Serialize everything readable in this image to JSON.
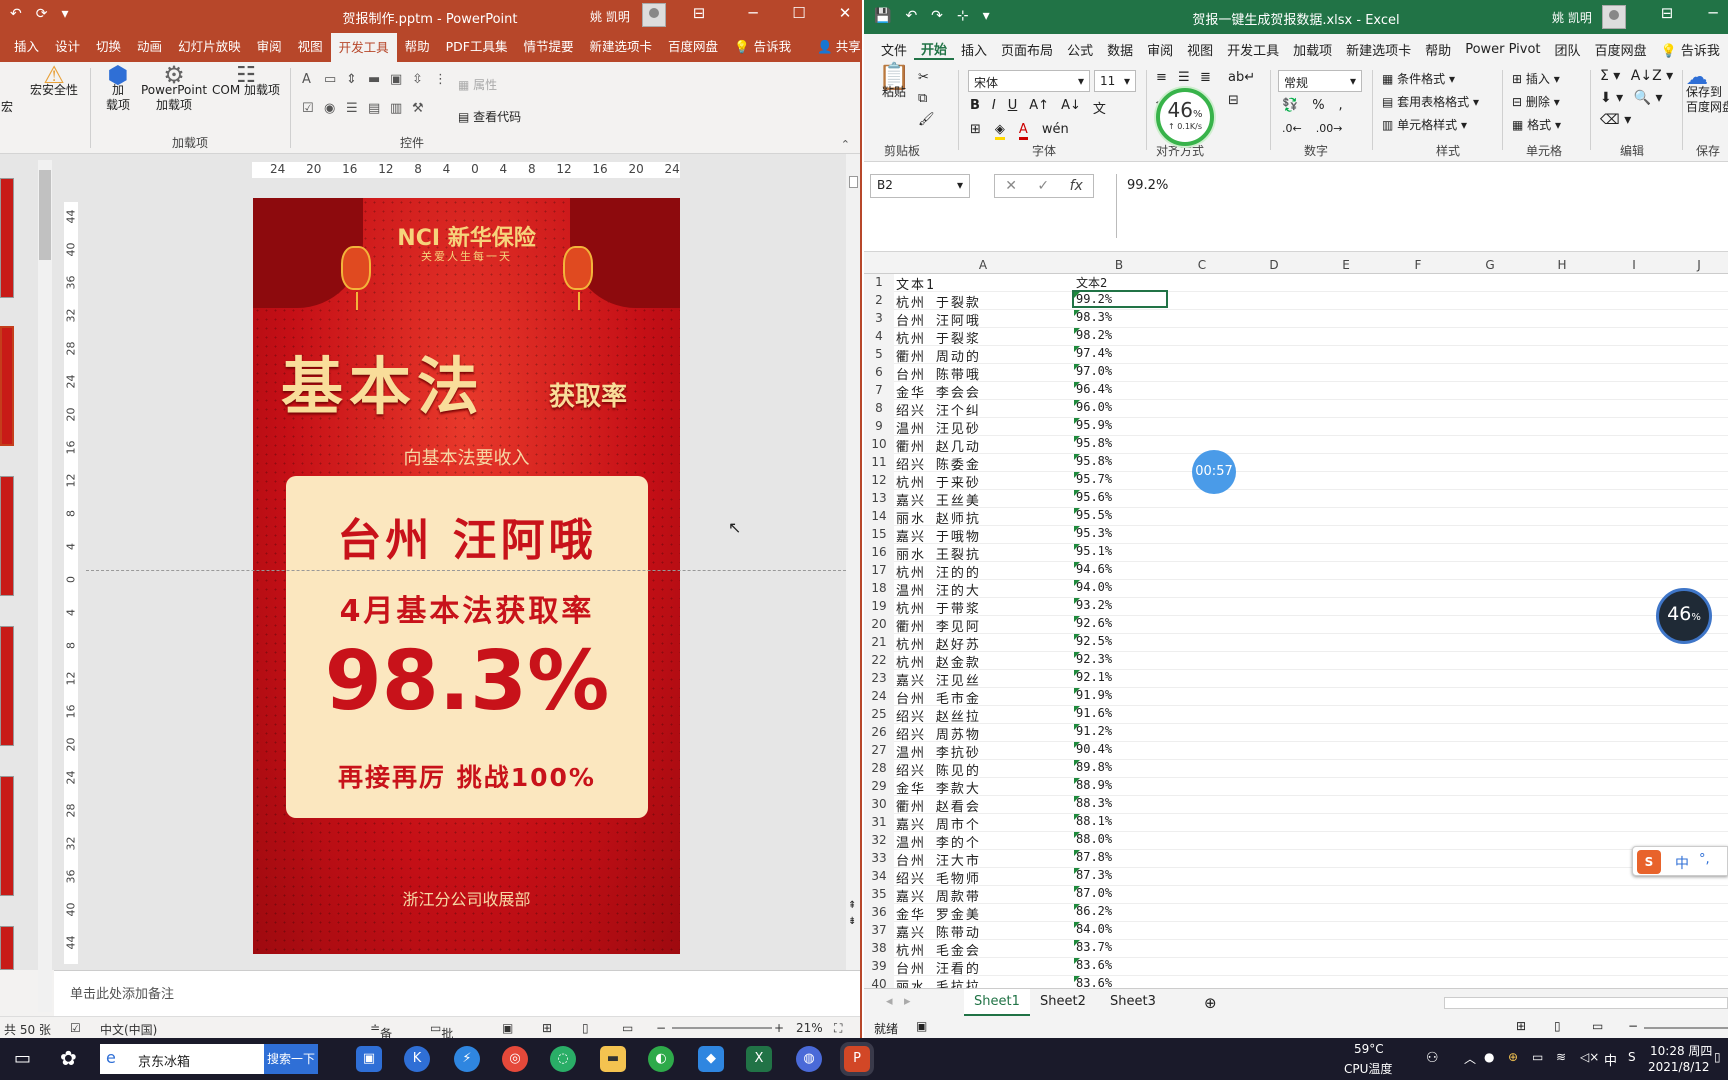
{
  "ppt": {
    "title": "贺报制作.pptm  -  PowerPoint",
    "user": "姚 凯明",
    "tabs": [
      "插入",
      "设计",
      "切换",
      "动画",
      "幻灯片放映",
      "审阅",
      "视图",
      "开发工具",
      "帮助",
      "PDF工具集",
      "情节提要",
      "新建选项卡",
      "百度网盘",
      "告诉我",
      "共享"
    ],
    "active_tab": "开发工具",
    "ribbon": {
      "macro": "宏",
      "macro_security": "宏安全性",
      "addins": "加\n载项",
      "ppt_addins": "PowerPoint\n加载项",
      "com_addins": "COM 加载项",
      "addins_group": "加载项",
      "properties": "属性",
      "view_code": "查看代码",
      "controls_group": "控件"
    },
    "hruler": [
      "24",
      "20",
      "16",
      "12",
      "8",
      "4",
      "0",
      "4",
      "8",
      "12",
      "16",
      "20",
      "24"
    ],
    "vruler": [
      "44",
      "40",
      "36",
      "32",
      "28",
      "24",
      "20",
      "16",
      "12",
      "8",
      "4",
      "0",
      "4",
      "8",
      "12",
      "16",
      "20",
      "24",
      "28",
      "32",
      "36",
      "40",
      "44"
    ],
    "slide": {
      "logo": "NCI 新华保险",
      "slogan": "关爱人生每一天",
      "big": "基本法",
      "big_sub": "获取率",
      "sub": "向基本法要收入",
      "name": "台州  汪阿哦",
      "line": "4月基本法获取率",
      "pct": "98.3%",
      "motto": "再接再厉  挑战100%",
      "foot": "浙江分公司收展部"
    },
    "notes_placeholder": "单击此处添加备注",
    "status": {
      "slides": "共 50 张",
      "lang": "中文(中国)",
      "notes": "备注",
      "comments": "批注",
      "zoom": "21%"
    }
  },
  "excel": {
    "title": "贺报一键生成贺报数据.xlsx  -  Excel",
    "user": "姚 凯明",
    "tabs": [
      "文件",
      "开始",
      "插入",
      "页面布局",
      "公式",
      "数据",
      "审阅",
      "视图",
      "开发工具",
      "加载项",
      "新建选项卡",
      "帮助",
      "Power Pivot",
      "团队",
      "百度网盘",
      "告诉我"
    ],
    "active_tab": "开始",
    "ribbon": {
      "paste": "粘贴",
      "clipboard": "剪贴板",
      "font_name": "宋体",
      "font_size": "11",
      "font_group": "字体",
      "align_group": "对齐方式",
      "number_format": "常规",
      "number_group": "数字",
      "cond_format": "条件格式",
      "table_format": "套用表格格式",
      "cell_style": "单元格样式",
      "styles_group": "样式",
      "insert": "插入",
      "delete": "删除",
      "format": "格式",
      "cells_group": "单元格",
      "editing_group": "编辑",
      "save_baidu": "保存到\n百度网盘",
      "save_group": "保存"
    },
    "namebox": "B2",
    "formula": "99.2%",
    "columns": [
      "A",
      "B",
      "C",
      "D",
      "E",
      "F",
      "G",
      "H",
      "I",
      "J"
    ],
    "rows": [
      [
        "文本1",
        "文本2"
      ],
      [
        "杭州 于裂款",
        "99.2%"
      ],
      [
        "台州 汪阿哦",
        "98.3%"
      ],
      [
        "杭州 于裂浆",
        "98.2%"
      ],
      [
        "衢州 周动的",
        "97.4%"
      ],
      [
        "台州 陈带哦",
        "97.0%"
      ],
      [
        "金华 李会会",
        "96.4%"
      ],
      [
        "绍兴 汪个纠",
        "96.0%"
      ],
      [
        "温州 汪见砂",
        "95.9%"
      ],
      [
        "衢州 赵几动",
        "95.8%"
      ],
      [
        "绍兴 陈委金",
        "95.8%"
      ],
      [
        "杭州 于来砂",
        "95.7%"
      ],
      [
        "嘉兴 王丝美",
        "95.6%"
      ],
      [
        "丽水 赵师抗",
        "95.5%"
      ],
      [
        "嘉兴 于哦物",
        "95.3%"
      ],
      [
        "丽水 王裂抗",
        "95.1%"
      ],
      [
        "杭州 汪的的",
        "94.6%"
      ],
      [
        "温州 汪的大",
        "94.0%"
      ],
      [
        "杭州 于带浆",
        "93.2%"
      ],
      [
        "衢州 李见阿",
        "92.6%"
      ],
      [
        "杭州 赵好苏",
        "92.5%"
      ],
      [
        "杭州 赵金款",
        "92.3%"
      ],
      [
        "嘉兴 汪见丝",
        "92.1%"
      ],
      [
        "台州 毛市金",
        "91.9%"
      ],
      [
        "绍兴 赵丝拉",
        "91.6%"
      ],
      [
        "绍兴 周苏物",
        "91.2%"
      ],
      [
        "温州 李抗砂",
        "90.4%"
      ],
      [
        "绍兴 陈见的",
        "89.8%"
      ],
      [
        "金华 李款大",
        "88.9%"
      ],
      [
        "衢州 赵看会",
        "88.3%"
      ],
      [
        "嘉兴 周市个",
        "88.1%"
      ],
      [
        "温州 李的个",
        "88.0%"
      ],
      [
        "台州 汪大市",
        "87.8%"
      ],
      [
        "绍兴 毛物师",
        "87.3%"
      ],
      [
        "嘉兴 周款带",
        "87.0%"
      ],
      [
        "金华 罗金美",
        "86.2%"
      ],
      [
        "嘉兴 陈带动",
        "84.0%"
      ],
      [
        "杭州 毛金会",
        "83.7%"
      ],
      [
        "台州 汪看的",
        "83.6%"
      ],
      [
        "丽水 毛抗拉",
        "83.6%"
      ]
    ],
    "sheets": [
      "Sheet1",
      "Sheet2",
      "Sheet3"
    ],
    "status": "就绪"
  },
  "overlays": {
    "gauge_value": "46",
    "gauge_unit": "%",
    "gauge_speed": "↑ 0.1K/s",
    "gauge2_value": "46",
    "timer": "00:57",
    "ime": "中"
  },
  "taskbar": {
    "search_text": "京东冰箱",
    "search_btn": "搜索一下",
    "temp": "59°C",
    "temp_label": "CPU温度",
    "ime": "中",
    "time": "10:28 周四",
    "date": "2021/8/12"
  },
  "colors": {
    "ppt_accent": "#b7472a",
    "excel_accent": "#217346",
    "slide_red": "#c8121a",
    "slide_cream": "#fbe7bf"
  }
}
